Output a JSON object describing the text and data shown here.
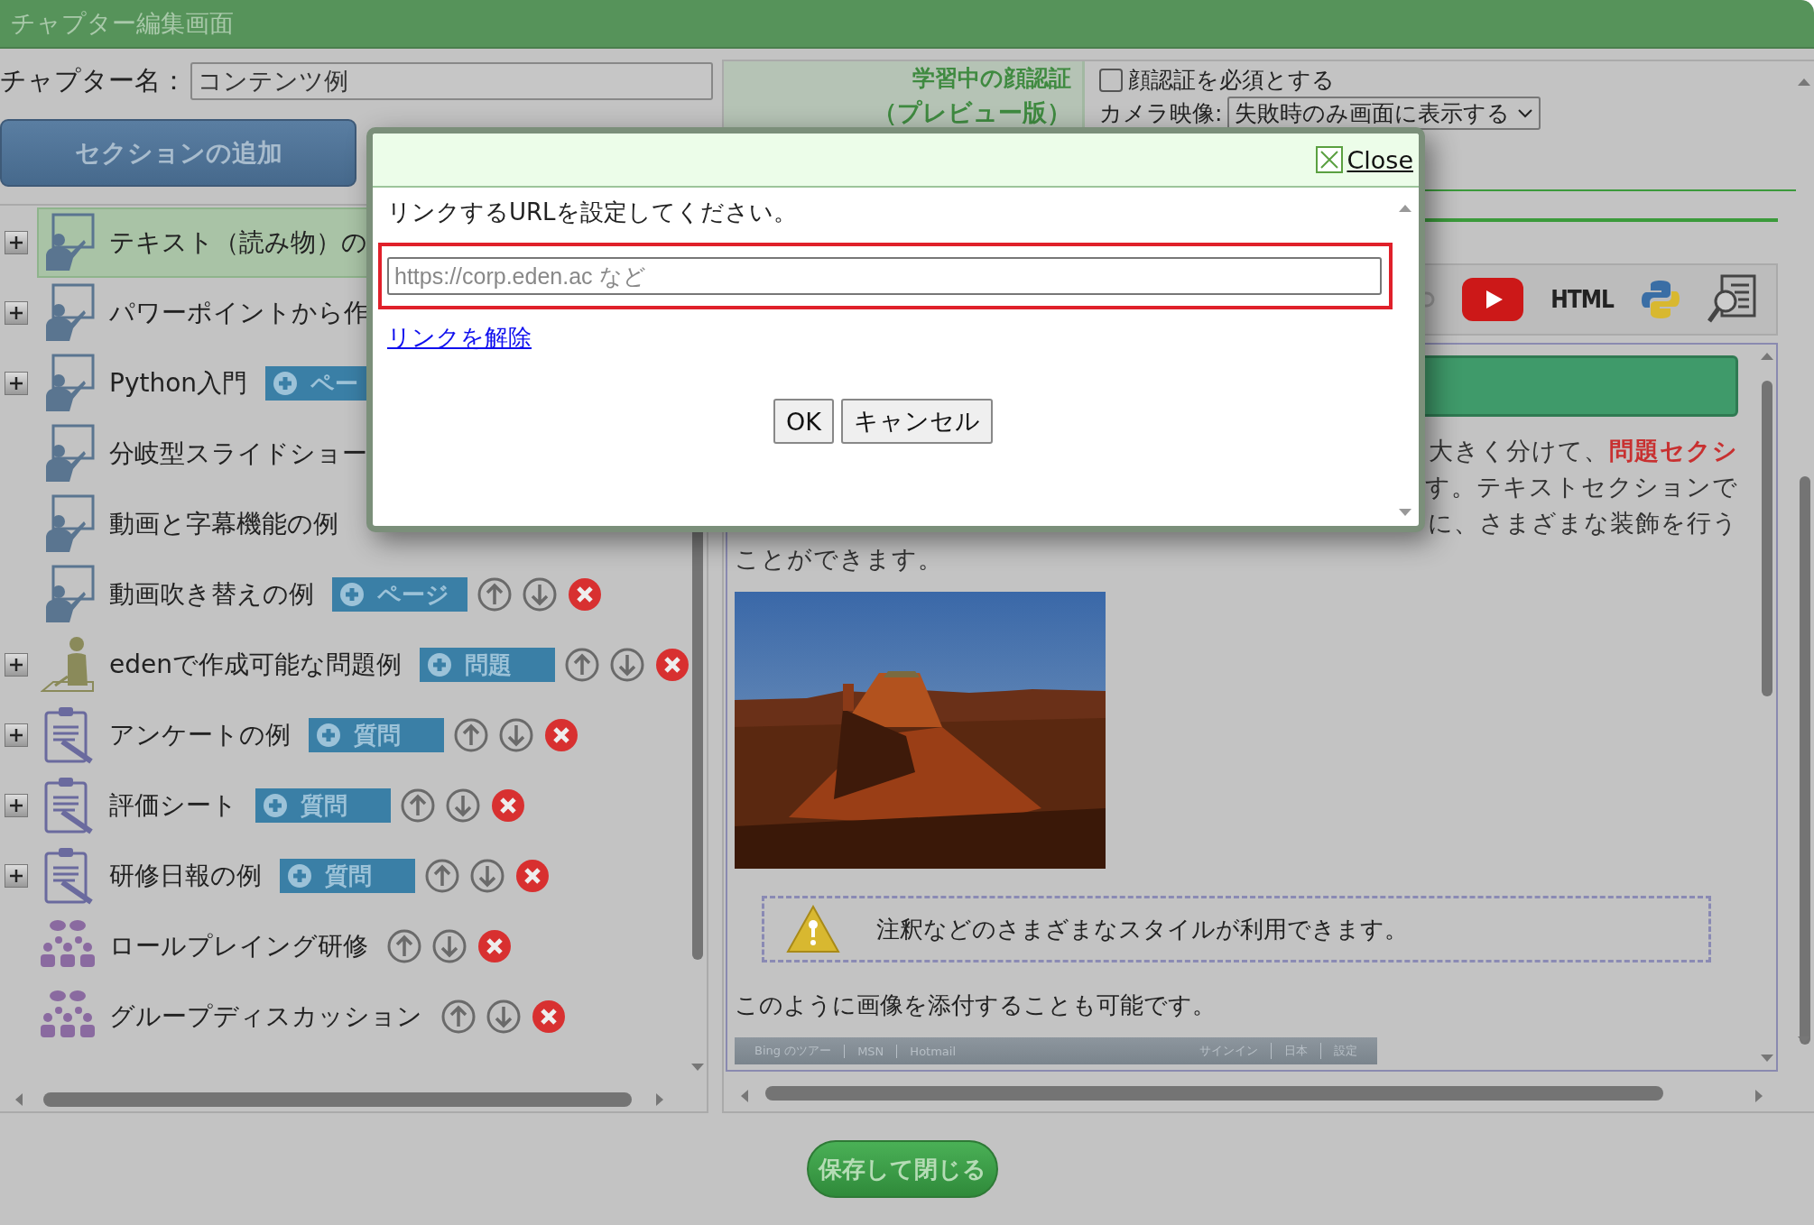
{
  "window": {
    "title": "チャプター編集画面"
  },
  "chapter": {
    "label": "チャプター名：",
    "value": "コンテンツ例"
  },
  "add_section_button": "セクションの追加",
  "sections": [
    {
      "label": "テキスト（読み物）の",
      "kind": "presenter",
      "expandable": true,
      "selected": true
    },
    {
      "label": "パワーポイントから作",
      "kind": "presenter",
      "expandable": true,
      "selected": false
    },
    {
      "label": "Python入門",
      "kind": "presenter",
      "expandable": true,
      "selected": false,
      "add_button": "ペー"
    },
    {
      "label": "分岐型スライドショー",
      "kind": "presenter",
      "expandable": false,
      "selected": false
    },
    {
      "label": "動画と字幕機能の例",
      "kind": "presenter",
      "expandable": false,
      "selected": false
    },
    {
      "label": "動画吹き替えの例",
      "kind": "presenter",
      "expandable": false,
      "selected": false,
      "add_button": "ページ",
      "controls": true
    },
    {
      "label": "edenで作成可能な問題例",
      "kind": "test",
      "expandable": true,
      "selected": false,
      "add_button": "問題",
      "controls": true
    },
    {
      "label": "アンケートの例",
      "kind": "clipboard",
      "expandable": true,
      "selected": false,
      "add_button": "質問",
      "controls": true
    },
    {
      "label": "評価シート",
      "kind": "clipboard",
      "expandable": true,
      "selected": false,
      "add_button": "質問",
      "controls": true
    },
    {
      "label": "研修日報の例",
      "kind": "clipboard",
      "expandable": true,
      "selected": false,
      "add_button": "質問",
      "controls": true
    },
    {
      "label": "ロールプレイング研修",
      "kind": "group",
      "expandable": false,
      "selected": false,
      "controls": true
    },
    {
      "label": "グループディスカッション",
      "kind": "group",
      "expandable": false,
      "selected": false,
      "controls": true
    }
  ],
  "face_auth": {
    "title": "学習中の顔認証",
    "subtitle": "（プレビュー版）",
    "required": {
      "label": "顔認証を必須とする",
      "checked": false
    },
    "camera": {
      "label": "カメラ映像:",
      "value": "失敗時のみ画面に表示する"
    }
  },
  "toolbar": [
    {
      "kind": "link"
    },
    {
      "kind": "youtube"
    },
    {
      "kind": "html",
      "label": "HTML"
    },
    {
      "kind": "python"
    },
    {
      "kind": "preview"
    }
  ],
  "content": {
    "lines": [
      "大きく分けて、**問題セクシ**",
      "す。テキストセクションで",
      "に、さまざまな装飾を行う",
      "ことができます。"
    ],
    "note": "注釈などのさまざまなスタイルが利用できます。",
    "caption": "このように画像を添付することも可能です。",
    "strip_left": [
      "Bing のツアー",
      "MSN",
      "Hotmail"
    ],
    "strip_right": [
      "サインイン",
      "日本",
      "設定"
    ]
  },
  "save_button": "保存して閉じる",
  "dialog": {
    "close": "Close",
    "prompt": "リンクするURLを設定してください。",
    "url_field": {
      "placeholder": "https://corp.eden.ac など"
    },
    "unlink": "リンクを解除",
    "buttons": [
      "OK",
      "キャンセル"
    ]
  }
}
